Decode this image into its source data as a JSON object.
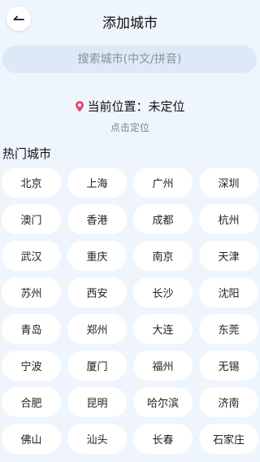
{
  "header": {
    "title": "添加城市",
    "back_icon": "arrow-left-icon"
  },
  "search": {
    "placeholder": "搜索城市(中文/拼音)",
    "value": ""
  },
  "location": {
    "icon": "map-pin-icon",
    "icon_color": "#e8456b",
    "label": "当前位置：未定位",
    "action": "点击定位"
  },
  "hot_cities": {
    "title": "热门城市",
    "items": [
      "北京",
      "上海",
      "广州",
      "深圳",
      "澳门",
      "香港",
      "成都",
      "杭州",
      "武汉",
      "重庆",
      "南京",
      "天津",
      "苏州",
      "西安",
      "长沙",
      "沈阳",
      "青岛",
      "郑州",
      "大连",
      "东莞",
      "宁波",
      "厦门",
      "福州",
      "无锡",
      "合肥",
      "昆明",
      "哈尔滨",
      "济南",
      "佛山",
      "汕头",
      "长春",
      "石家庄"
    ]
  },
  "colors": {
    "background": "#eef5fc",
    "search_background": "#dde9f6",
    "chip_background": "#ffffff"
  }
}
